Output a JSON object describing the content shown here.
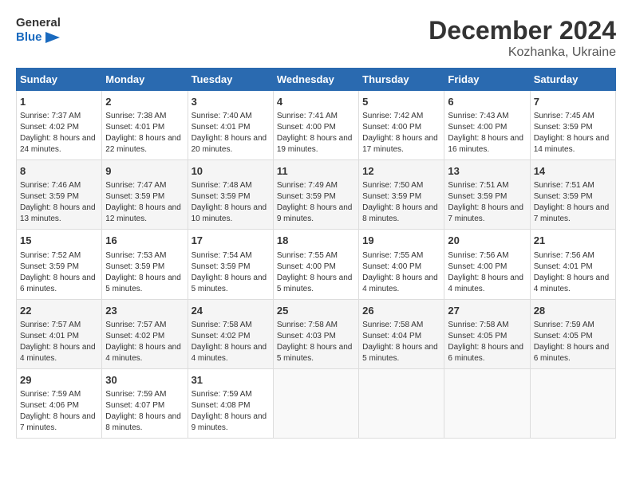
{
  "header": {
    "logo_line1": "General",
    "logo_line2": "Blue",
    "title": "December 2024",
    "subtitle": "Kozhanka, Ukraine"
  },
  "days_of_week": [
    "Sunday",
    "Monday",
    "Tuesday",
    "Wednesday",
    "Thursday",
    "Friday",
    "Saturday"
  ],
  "weeks": [
    [
      {
        "day": "1",
        "sunrise": "7:37 AM",
        "sunset": "4:02 PM",
        "daylight": "8 hours and 24 minutes."
      },
      {
        "day": "2",
        "sunrise": "7:38 AM",
        "sunset": "4:01 PM",
        "daylight": "8 hours and 22 minutes."
      },
      {
        "day": "3",
        "sunrise": "7:40 AM",
        "sunset": "4:01 PM",
        "daylight": "8 hours and 20 minutes."
      },
      {
        "day": "4",
        "sunrise": "7:41 AM",
        "sunset": "4:00 PM",
        "daylight": "8 hours and 19 minutes."
      },
      {
        "day": "5",
        "sunrise": "7:42 AM",
        "sunset": "4:00 PM",
        "daylight": "8 hours and 17 minutes."
      },
      {
        "day": "6",
        "sunrise": "7:43 AM",
        "sunset": "4:00 PM",
        "daylight": "8 hours and 16 minutes."
      },
      {
        "day": "7",
        "sunrise": "7:45 AM",
        "sunset": "3:59 PM",
        "daylight": "8 hours and 14 minutes."
      }
    ],
    [
      {
        "day": "8",
        "sunrise": "7:46 AM",
        "sunset": "3:59 PM",
        "daylight": "8 hours and 13 minutes."
      },
      {
        "day": "9",
        "sunrise": "7:47 AM",
        "sunset": "3:59 PM",
        "daylight": "8 hours and 12 minutes."
      },
      {
        "day": "10",
        "sunrise": "7:48 AM",
        "sunset": "3:59 PM",
        "daylight": "8 hours and 10 minutes."
      },
      {
        "day": "11",
        "sunrise": "7:49 AM",
        "sunset": "3:59 PM",
        "daylight": "8 hours and 9 minutes."
      },
      {
        "day": "12",
        "sunrise": "7:50 AM",
        "sunset": "3:59 PM",
        "daylight": "8 hours and 8 minutes."
      },
      {
        "day": "13",
        "sunrise": "7:51 AM",
        "sunset": "3:59 PM",
        "daylight": "8 hours and 7 minutes."
      },
      {
        "day": "14",
        "sunrise": "7:51 AM",
        "sunset": "3:59 PM",
        "daylight": "8 hours and 7 minutes."
      }
    ],
    [
      {
        "day": "15",
        "sunrise": "7:52 AM",
        "sunset": "3:59 PM",
        "daylight": "8 hours and 6 minutes."
      },
      {
        "day": "16",
        "sunrise": "7:53 AM",
        "sunset": "3:59 PM",
        "daylight": "8 hours and 5 minutes."
      },
      {
        "day": "17",
        "sunrise": "7:54 AM",
        "sunset": "3:59 PM",
        "daylight": "8 hours and 5 minutes."
      },
      {
        "day": "18",
        "sunrise": "7:55 AM",
        "sunset": "4:00 PM",
        "daylight": "8 hours and 5 minutes."
      },
      {
        "day": "19",
        "sunrise": "7:55 AM",
        "sunset": "4:00 PM",
        "daylight": "8 hours and 4 minutes."
      },
      {
        "day": "20",
        "sunrise": "7:56 AM",
        "sunset": "4:00 PM",
        "daylight": "8 hours and 4 minutes."
      },
      {
        "day": "21",
        "sunrise": "7:56 AM",
        "sunset": "4:01 PM",
        "daylight": "8 hours and 4 minutes."
      }
    ],
    [
      {
        "day": "22",
        "sunrise": "7:57 AM",
        "sunset": "4:01 PM",
        "daylight": "8 hours and 4 minutes."
      },
      {
        "day": "23",
        "sunrise": "7:57 AM",
        "sunset": "4:02 PM",
        "daylight": "8 hours and 4 minutes."
      },
      {
        "day": "24",
        "sunrise": "7:58 AM",
        "sunset": "4:02 PM",
        "daylight": "8 hours and 4 minutes."
      },
      {
        "day": "25",
        "sunrise": "7:58 AM",
        "sunset": "4:03 PM",
        "daylight": "8 hours and 5 minutes."
      },
      {
        "day": "26",
        "sunrise": "7:58 AM",
        "sunset": "4:04 PM",
        "daylight": "8 hours and 5 minutes."
      },
      {
        "day": "27",
        "sunrise": "7:58 AM",
        "sunset": "4:05 PM",
        "daylight": "8 hours and 6 minutes."
      },
      {
        "day": "28",
        "sunrise": "7:59 AM",
        "sunset": "4:05 PM",
        "daylight": "8 hours and 6 minutes."
      }
    ],
    [
      {
        "day": "29",
        "sunrise": "7:59 AM",
        "sunset": "4:06 PM",
        "daylight": "8 hours and 7 minutes."
      },
      {
        "day": "30",
        "sunrise": "7:59 AM",
        "sunset": "4:07 PM",
        "daylight": "8 hours and 8 minutes."
      },
      {
        "day": "31",
        "sunrise": "7:59 AM",
        "sunset": "4:08 PM",
        "daylight": "8 hours and 9 minutes."
      },
      null,
      null,
      null,
      null
    ]
  ],
  "labels": {
    "sunrise": "Sunrise:",
    "sunset": "Sunset:",
    "daylight": "Daylight:"
  }
}
